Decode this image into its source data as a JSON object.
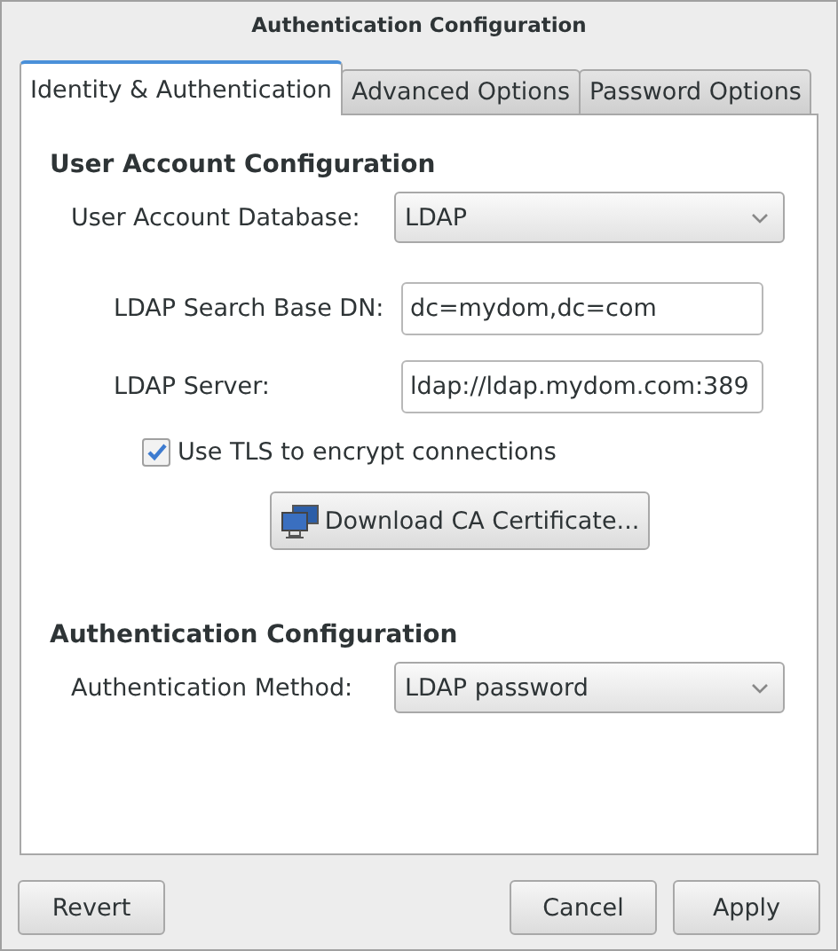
{
  "window": {
    "title": "Authentication Configuration"
  },
  "tabs": [
    {
      "label": "Identity & Authentication",
      "selected": true
    },
    {
      "label": "Advanced Options",
      "selected": false
    },
    {
      "label": "Password Options",
      "selected": false
    }
  ],
  "user_account": {
    "heading": "User Account Configuration",
    "database_label": "User Account Database:",
    "database_value": "LDAP",
    "fields": [
      {
        "label": "LDAP Search Base DN:",
        "value": "dc=mydom,dc=com"
      },
      {
        "label": "LDAP Server:",
        "value": "ldap://ldap.mydom.com:389"
      }
    ],
    "tls": {
      "label": "Use TLS to encrypt connections",
      "checked": true
    },
    "download_button": "Download CA Certificate..."
  },
  "authentication": {
    "heading": "Authentication Configuration",
    "method_label": "Authentication Method:",
    "method_value": "LDAP password"
  },
  "buttons": {
    "left": [
      "Revert"
    ],
    "right": [
      "Cancel",
      "Apply"
    ]
  }
}
